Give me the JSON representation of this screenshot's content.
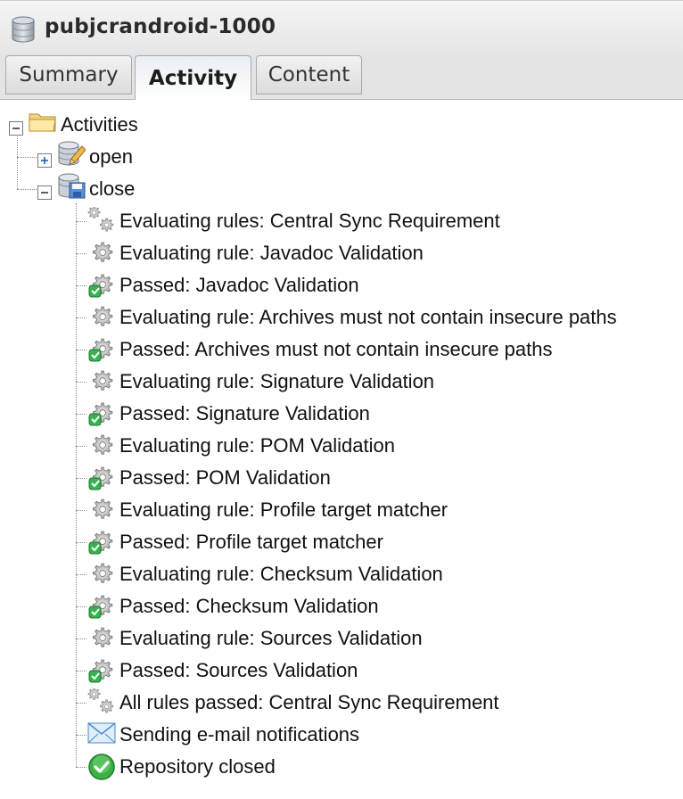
{
  "header": {
    "title": "pubjcrandroid-1000"
  },
  "tabs": [
    {
      "label": "Summary"
    },
    {
      "label": "Activity"
    },
    {
      "label": "Content"
    }
  ],
  "tree": {
    "root_label": "Activities",
    "open_label": "open",
    "close_label": "close",
    "events": [
      {
        "label": "Evaluating rules: Central Sync Requirement",
        "icon": "gears-icon"
      },
      {
        "label": "Evaluating rule: Javadoc Validation",
        "icon": "gear-icon"
      },
      {
        "label": "Passed: Javadoc Validation",
        "icon": "gear-passed-icon"
      },
      {
        "label": "Evaluating rule: Archives must not contain insecure paths",
        "icon": "gear-icon"
      },
      {
        "label": "Passed: Archives must not contain insecure paths",
        "icon": "gear-passed-icon"
      },
      {
        "label": "Evaluating rule: Signature Validation",
        "icon": "gear-icon"
      },
      {
        "label": "Passed: Signature Validation",
        "icon": "gear-passed-icon"
      },
      {
        "label": "Evaluating rule: POM Validation",
        "icon": "gear-icon"
      },
      {
        "label": "Passed: POM Validation",
        "icon": "gear-passed-icon"
      },
      {
        "label": "Evaluating rule: Profile target matcher",
        "icon": "gear-icon"
      },
      {
        "label": "Passed: Profile target matcher",
        "icon": "gear-passed-icon"
      },
      {
        "label": "Evaluating rule: Checksum Validation",
        "icon": "gear-icon"
      },
      {
        "label": "Passed: Checksum Validation",
        "icon": "gear-passed-icon"
      },
      {
        "label": "Evaluating rule: Sources Validation",
        "icon": "gear-icon"
      },
      {
        "label": "Passed: Sources Validation",
        "icon": "gear-passed-icon"
      },
      {
        "label": "All rules passed: Central Sync Requirement",
        "icon": "gears-icon"
      },
      {
        "label": "Sending e-mail notifications",
        "icon": "envelope-icon"
      },
      {
        "label": "Repository closed",
        "icon": "check-circle-icon"
      }
    ]
  }
}
